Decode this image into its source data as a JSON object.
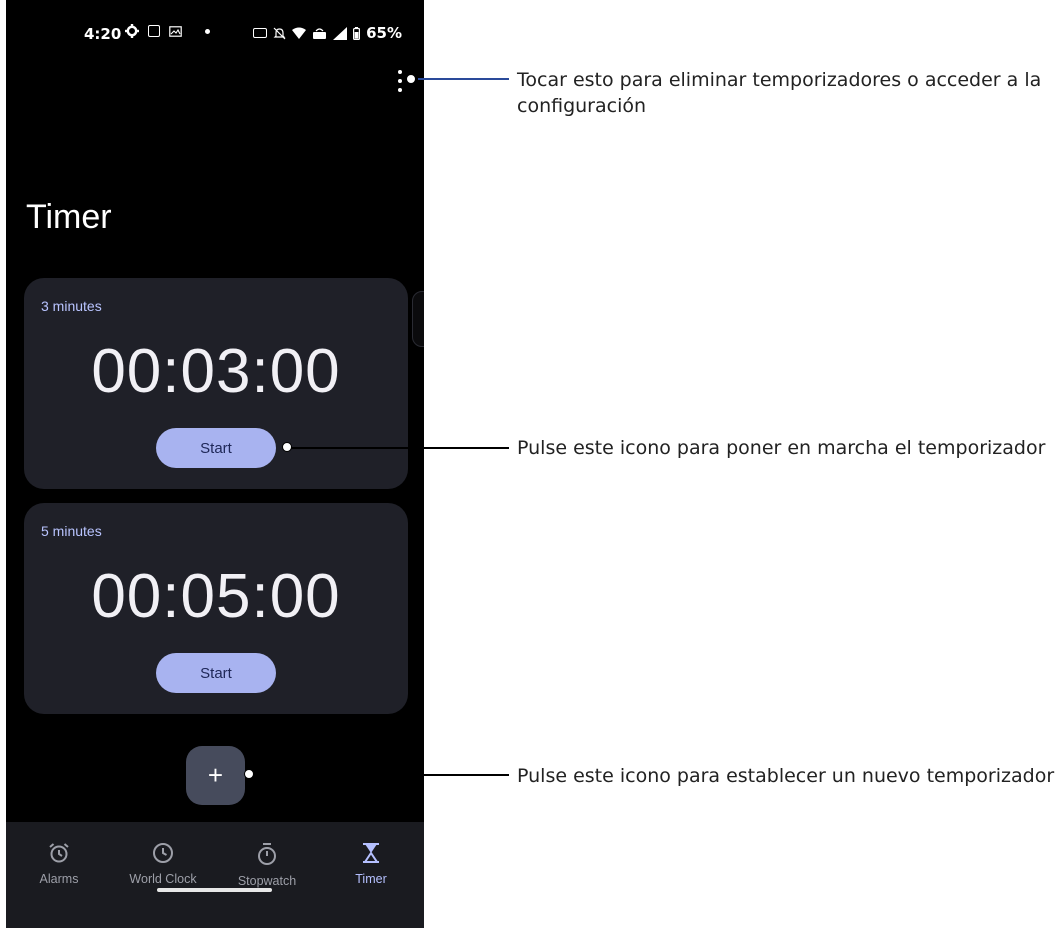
{
  "status_bar": {
    "time": "4:20",
    "battery": "65%"
  },
  "app": {
    "title": "Timer"
  },
  "timers": [
    {
      "label": "3 minutes",
      "time": "00:03:00",
      "button": "Start"
    },
    {
      "label": "5 minutes",
      "time": "00:05:00",
      "button": "Start"
    }
  ],
  "fab": {
    "label": "+"
  },
  "nav": {
    "items": [
      {
        "label": "Alarms",
        "icon": "alarm-icon"
      },
      {
        "label": "World Clock",
        "icon": "clock-icon"
      },
      {
        "label": "Stopwatch",
        "icon": "stopwatch-icon"
      },
      {
        "label": "Timer",
        "icon": "hourglass-icon",
        "active": true
      }
    ]
  },
  "callouts": [
    {
      "text": "Tocar esto para eliminar temporizadores o acceder a la configuración"
    },
    {
      "text": "Pulse este icono para poner en marcha el temporizador"
    },
    {
      "text": "Pulse este icono para establecer un nuevo temporizador"
    }
  ],
  "colors": {
    "accent": "#a8b3f0",
    "card_bg": "#1f2028",
    "label": "#b9c4ff"
  }
}
